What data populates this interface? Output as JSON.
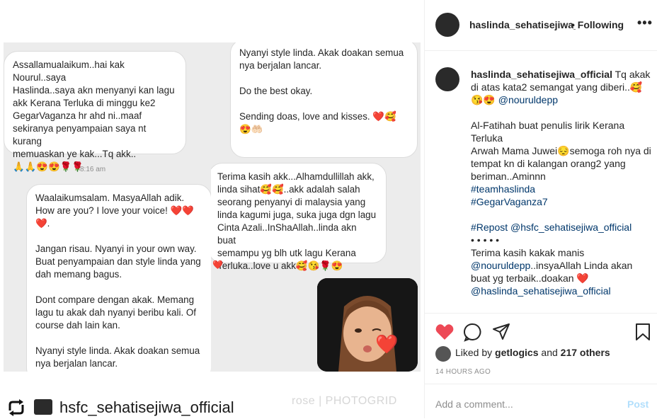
{
  "photo": {
    "left_column": {
      "bubble1": "Assallamualaikum..hai kak Nourul..saya\nHaslinda..saya akn menyanyi kan lagu\nakk Kerana Terluka di minggu ke2\nGegarVaganza hr ahd ni..maaf\nsekiranya penyampaian saya nt kurang\nmemuaskan ye kak...Tq akk..\n🙏🙏😍😍🌹🌹",
      "timestamp": "8:16 am",
      "bubble2": "Waalaikumsalam. MasyaAllah adik.\nHow are you? I love your voice! ❤️❤️\n❤️.\n\nJangan risau. Nyanyi in your own way.\nBuat penyampaian dan style linda yang\ndah memang bagus.\n\nDont compare dengan akak. Memang\nlagu tu akak dah nyanyi beribu kali. Of\ncourse dah lain kan.\n\nNyanyi style linda. Akak doakan semua\nnya berjalan lancar."
    },
    "right_column": {
      "bubble1": "Nyanyi style linda. Akak doakan semua\nnya berjalan lancar.\n\nDo the best okay.\n\nSending doas, love and kisses. ❤️🥰\n😍🤲🏻",
      "bubble2": "Terima kasih akk...Alhamdullillah akk,\nlinda sihat🥰🥰..akk adalah salah\nseorang penyanyi di malaysia yang\nlinda kagumi juga, suka juga dgn lagu\nCinta Azali..InShaAllah..linda akn buat\nsemampu yg blh utk lagu Kerana\nTerluka..love u akk🥰😘🌹😍",
      "reaction": "❤️",
      "memoji_heart": "❤️"
    },
    "footer_handle": "hsfc_sehatisejiwa_official",
    "watermark": "rose | PHOTOGRID"
  },
  "header": {
    "username": "haslinda_sehatisejiwa_official",
    "follow_status": "• Following",
    "more": "•••"
  },
  "caption": {
    "username": "haslinda_sehatisejiwa_official",
    "line1": " Tq akak di atas kata2 semangat yang diberi..🥰😘😍 ",
    "mention1": "@nouruldepp",
    "para2": "Al-Fatihah buat penulis lirik Kerana Terluka",
    "para3": "Arwah Mama Juwei😔semoga roh nya di tempat kn di kalangan orang2 yang beriman..Aminnn",
    "hashtag1": "#teamhaslinda",
    "hashtag2": "#GegarVaganza7",
    "repost_prefix": "#Repost",
    "repost_handle": " @hsfc_sehatisejiwa_official",
    "dots": "• • • • •",
    "thanks": "Terima kasih kakak manis",
    "mention2": "@nouruldepp",
    "thanks_rest": "..insyaAllah Linda akan buat yg terbaik..doakan ❤️",
    "mention3": "@haslinda_sehatisejiwa_official"
  },
  "likes": {
    "prefix": "Liked by ",
    "user": "getlogics",
    "middle": " and ",
    "count": "217 others"
  },
  "time_ago": "14 HOURS AGO",
  "comment": {
    "placeholder": "Add a comment...",
    "post_label": "Post"
  },
  "colors": {
    "like_heart": "#ed4956",
    "link": "#00376b",
    "post_disabled": "#b2dffc"
  }
}
